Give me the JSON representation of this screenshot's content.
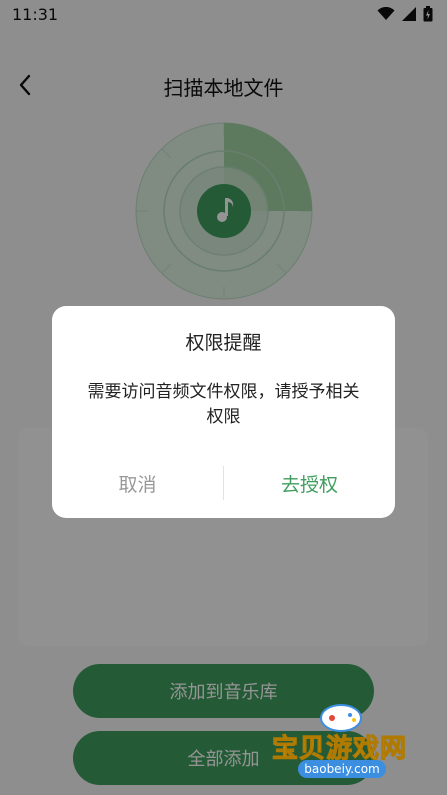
{
  "status_bar": {
    "time": "11:31"
  },
  "header": {
    "title": "扫描本地文件"
  },
  "buttons": {
    "add_to_library": "添加到音乐库",
    "add_all": "全部添加"
  },
  "dialog": {
    "title": "权限提醒",
    "message": "需要访问音频文件权限，请授予相关权限",
    "cancel_label": "取消",
    "confirm_label": "去授权"
  },
  "watermark": {
    "text": "宝贝游戏网",
    "url": "baobeiy.com"
  },
  "colors": {
    "accent": "#3f9e5d",
    "overlay": "rgba(0,0,0,0.42)",
    "cancel_text": "#999999"
  },
  "icons": [
    "back-arrow-icon",
    "wifi-icon",
    "signal-icon",
    "battery-icon",
    "music-note-icon"
  ]
}
